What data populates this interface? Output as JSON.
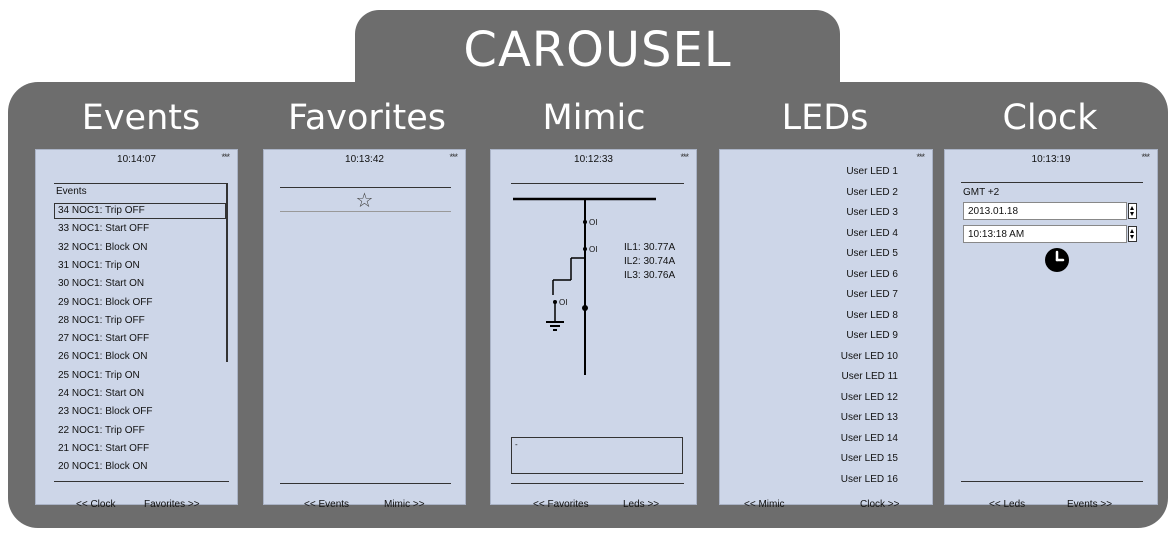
{
  "title": "CAROUSEL",
  "events": {
    "heading": "Events",
    "time": "10:14:07",
    "dots": "***",
    "list_header": "Events",
    "items": [
      "34  NOC1: Trip OFF",
      "33  NOC1: Start OFF",
      "32  NOC1: Block ON",
      "31  NOC1: Trip ON",
      "30  NOC1: Start ON",
      "29  NOC1: Block OFF",
      "28  NOC1: Trip OFF",
      "27  NOC1: Start OFF",
      "26  NOC1: Block ON",
      "25  NOC1: Trip ON",
      "24  NOC1: Start ON",
      "23  NOC1: Block OFF",
      "22  NOC1: Trip OFF",
      "21  NOC1: Start OFF",
      "20  NOC1: Block ON"
    ],
    "nav_left": "<< Clock",
    "nav_right": "Favorites >>"
  },
  "favorites": {
    "heading": "Favorites",
    "time": "10:13:42",
    "dots": "***",
    "star": "☆",
    "nav_left": "<< Events",
    "nav_right": "Mimic >>"
  },
  "mimic": {
    "heading": "Mimic",
    "time": "10:12:33",
    "dots": "***",
    "switch_label_1": "OI",
    "switch_label_2": "OI",
    "switch_label_3": "OI",
    "il1": "IL1: 30.77A",
    "il2": "IL2: 30.74A",
    "il3": "IL3: 30.76A",
    "box_text": "-",
    "nav_left": "<< Favorites",
    "nav_right": "Leds >>"
  },
  "leds": {
    "heading": "LEDs",
    "dots": "***",
    "items": [
      "User LED 1",
      "User LED 2",
      "User LED 3",
      "User LED 4",
      "User LED 5",
      "User LED 6",
      "User LED 7",
      "User LED 8",
      "User LED 9",
      "User LED 10",
      "User LED 11",
      "User LED 12",
      "User LED 13",
      "User LED 14",
      "User LED 15",
      "User LED 16"
    ],
    "nav_left": "<< Mimic",
    "nav_right": "Clock >>"
  },
  "clock": {
    "heading": "Clock",
    "time": "10:13:19",
    "dots": "***",
    "timezone": "GMT +2",
    "date_value": "2013.01.18",
    "time_value": "10:13:18 AM",
    "nav_left": "<< Leds",
    "nav_right": "Events >>"
  },
  "colors": {
    "frame": "#6d6d6d",
    "screen": "#cdd6e8",
    "title_text": "#ffffff"
  }
}
